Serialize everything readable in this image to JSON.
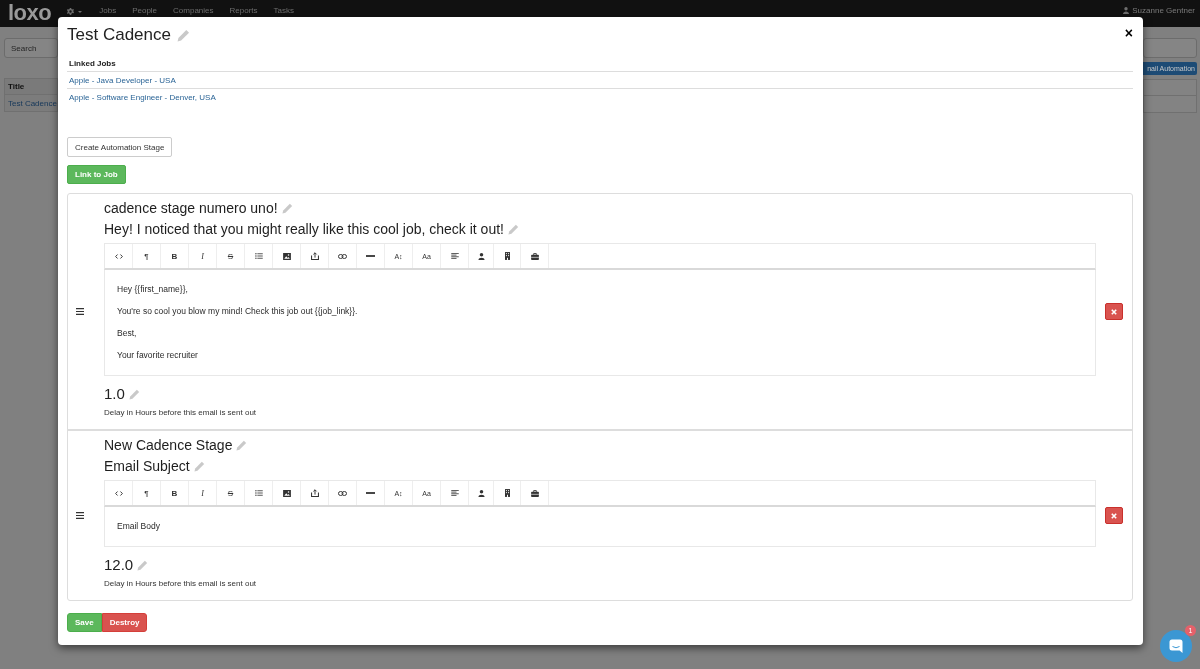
{
  "nav_bar": {
    "logo": "loxo",
    "menu": [
      "Jobs",
      "People",
      "Companies",
      "Reports",
      "Tasks"
    ],
    "user": "Suzanne Gentner"
  },
  "page": {
    "search": {
      "placeholder": "Search"
    },
    "button": "nail Automation",
    "table": {
      "columns": [
        "Title"
      ],
      "rows": [
        [
          "Test Cadence"
        ]
      ]
    }
  },
  "modal": {
    "title": "Test Cadence",
    "close": "×",
    "linked_jobs": {
      "heading": "Linked Jobs",
      "rows": [
        "Apple - Java Developer - USA",
        "Apple - Software Engineer - Denver, USA"
      ]
    },
    "buttons": [
      {
        "label": "Create Automation Stage",
        "kind": "default"
      },
      {
        "label": "Link to Job",
        "kind": "success"
      }
    ],
    "stages": [
      {
        "name": "cadence stage numero uno!",
        "subject": "Hey! I noticed that you might really like this cool job, check it out!",
        "toolbar": [
          {
            "kind": "code"
          },
          {
            "kind": "paragraph",
            "label": "¶"
          },
          {
            "kind": "bold",
            "label": "B"
          },
          {
            "kind": "italic",
            "label": "I"
          },
          {
            "kind": "strikethrough",
            "label": "S"
          },
          {
            "kind": "list"
          },
          {
            "kind": "picture"
          },
          {
            "kind": "upload"
          },
          {
            "kind": "link"
          },
          {
            "kind": "rule"
          },
          {
            "kind": "font-size",
            "label": "A↕"
          },
          {
            "kind": "text-case",
            "label": "Aa"
          },
          {
            "kind": "align"
          },
          {
            "kind": "person"
          },
          {
            "kind": "building"
          },
          {
            "kind": "briefcase"
          }
        ],
        "body": [
          "Hey {{first_name}},",
          "You're so cool you blow my mind! Check this job out {{job_link}}.",
          "Best,",
          "Your favorite recruiter"
        ],
        "delay": "1.0",
        "delay_label": "Delay in Hours before this email is sent out"
      },
      {
        "name": "New Cadence Stage",
        "subject": "Email Subject",
        "toolbar": [
          {
            "kind": "code"
          },
          {
            "kind": "paragraph",
            "label": "¶"
          },
          {
            "kind": "bold",
            "label": "B"
          },
          {
            "kind": "italic",
            "label": "I"
          },
          {
            "kind": "strikethrough",
            "label": "S"
          },
          {
            "kind": "list"
          },
          {
            "kind": "picture"
          },
          {
            "kind": "upload"
          },
          {
            "kind": "link"
          },
          {
            "kind": "rule"
          },
          {
            "kind": "font-size",
            "label": "A↕"
          },
          {
            "kind": "text-case",
            "label": "Aa"
          },
          {
            "kind": "align"
          },
          {
            "kind": "person"
          },
          {
            "kind": "building"
          },
          {
            "kind": "briefcase"
          }
        ],
        "body": [
          "Email Body"
        ],
        "delay": "12.0",
        "delay_label": "Delay in Hours before this email is sent out"
      }
    ],
    "actions": [
      {
        "label": "Save",
        "kind": "success"
      },
      {
        "label": "Destroy",
        "kind": "danger"
      }
    ]
  },
  "chat": {
    "badge": "1"
  }
}
